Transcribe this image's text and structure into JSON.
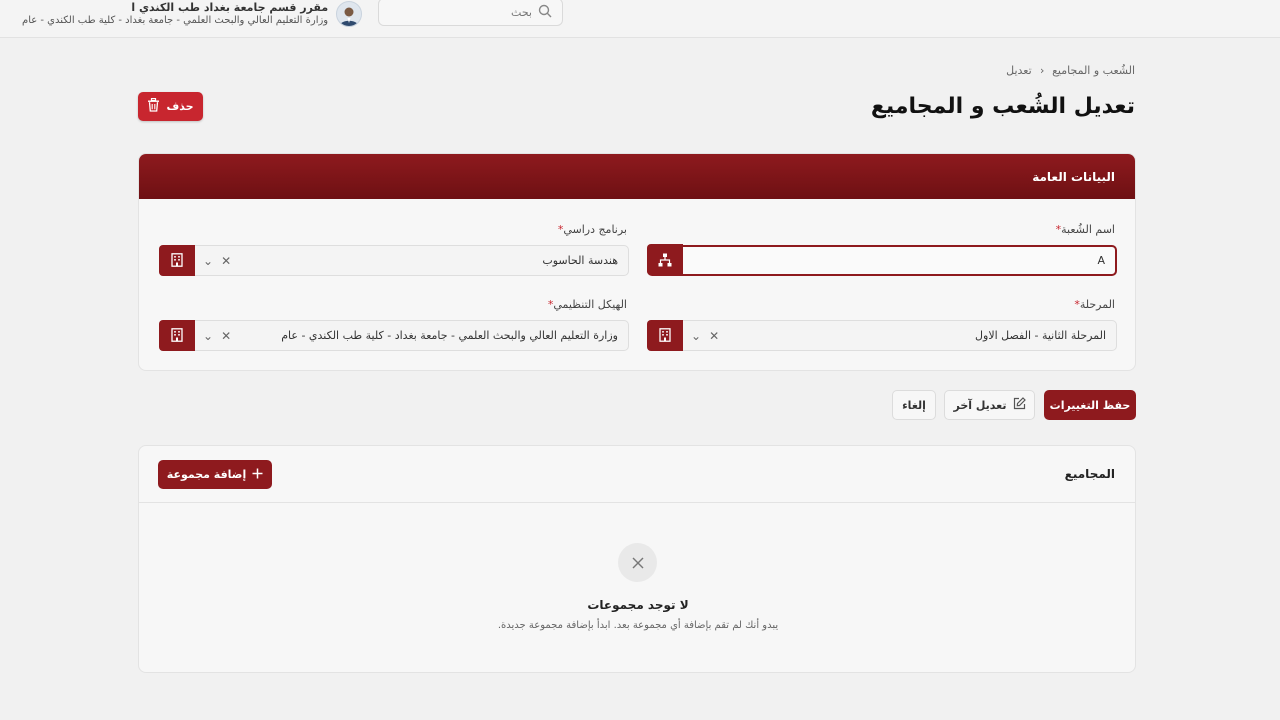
{
  "header": {
    "user_name": "مقرر قسم جامعة بغداد طب الكندي ا",
    "user_org": "وزارة التعليم العالي والبحث العلمي - جامعة بغداد - كلية طب الكندي - عام",
    "search_placeholder": "بحث",
    "avatar_icon": "user-avatar-icon",
    "search_icon": "search-icon"
  },
  "breadcrumb": {
    "parent": "الشُعب و المجاميع",
    "separator": "›",
    "current": "تعديل"
  },
  "page": {
    "title": "تعديل الشُعب و المجاميع",
    "delete_label": "حذف"
  },
  "general_card": {
    "title": "البيانات العامة",
    "fields": {
      "section_name": {
        "label": "اسم الشُعبة",
        "required": "*",
        "value": "A",
        "icon": "hierarchy-icon"
      },
      "study_program": {
        "label": "برنامج دراسي",
        "required": "*",
        "value": "هندسة الحاسوب",
        "icon": "building-icon"
      },
      "stage": {
        "label": "المرحلة",
        "required": "*",
        "value": "المرحلة الثانية - الفصل الاول",
        "icon": "building-icon"
      },
      "org_structure": {
        "label": "الهيكل التنظيمي",
        "required": "*",
        "value": "وزارة التعليم العالي والبحث العلمي - جامعة بغداد - كلية طب الكندي - عام",
        "icon": "building-icon"
      }
    },
    "clear_glyph": "✕",
    "dropdown_glyph": "⌄"
  },
  "actions": {
    "save_label": "حفظ التغييرات",
    "edit_other_label": "تعديل آخر",
    "cancel_label": "إلغاء"
  },
  "groups": {
    "title": "المجاميع",
    "add_label": "إضافة مجموعة",
    "empty_title": "لا توجد مجموعات",
    "empty_subtitle": "يبدو أنك لم تقم بإضافة أي مجموعة بعد. ابدأ بإضافة مجموعة جديدة."
  },
  "colors": {
    "brand": "#8e1a1e",
    "danger": "#c8262f",
    "background": "#f1f1f1"
  }
}
